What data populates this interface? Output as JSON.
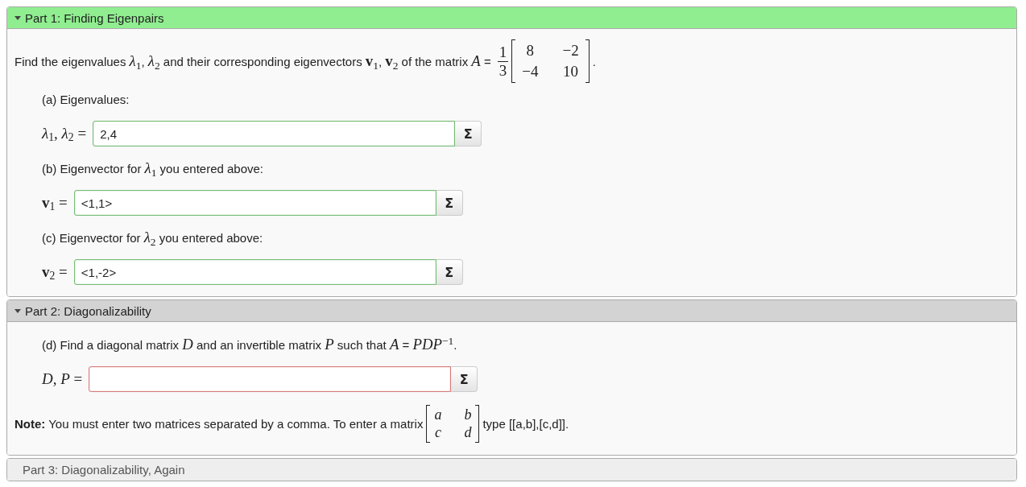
{
  "parts": [
    {
      "title": "Part 1: Finding Eigenpairs",
      "completed": true,
      "locked": false,
      "expanded": true,
      "intro": [
        {
          "kind": "text",
          "text": "Find the eigenvalues *λ*$_{1}$, *λ*$_{2}$ and their corresponding eigenvectors **v**$_{1}$, **v**$_{2}$ of the matrix *A* ="
        },
        {
          "kind": "fraction",
          "numerator": "1",
          "denominator": "3"
        },
        {
          "kind": "matrix",
          "rows": [
            [
              "8",
              "−2"
            ],
            [
              "−4",
              "10"
            ]
          ]
        },
        {
          "kind": "text",
          "text": "."
        }
      ],
      "questions": [
        {
          "prompt": "(a) Eigenvalues:",
          "label": "*λ*$_{1}$, *λ*$_{2}$ =",
          "value": "2,4",
          "correct": true,
          "button": "Σ"
        },
        {
          "prompt": "(b) Eigenvector for *λ*$_{1}$ you entered above:",
          "label": "**v**$_{1}$ =",
          "value": "<1,1>",
          "correct": true,
          "button": "Σ"
        },
        {
          "prompt": "(c) Eigenvector for *λ*$_{2}$ you entered above:",
          "label": "**v**$_{2}$ =",
          "value": "<1,-2>",
          "correct": true,
          "button": "Σ"
        }
      ]
    },
    {
      "title": "Part 2: Diagonalizability",
      "completed": false,
      "locked": false,
      "expanded": true,
      "questions": [
        {
          "prompt": "(d) Find a diagonal matrix *D* and an invertible matrix *P* such that *A* = *PDP*$^{−1}$.",
          "label": "*D*, *P* =",
          "correct": false,
          "button": "Σ"
        }
      ],
      "note": [
        {
          "kind": "text",
          "text": "**Note:** You must enter two matrices separated by a comma. To enter a matrix"
        },
        {
          "kind": "symbolic_matrix",
          "rows": [
            [
              "a",
              "b"
            ],
            [
              "c",
              "d"
            ]
          ]
        },
        {
          "kind": "text",
          "text": "type [[a,b],[c,d]]."
        }
      ]
    },
    {
      "title": "Part 3: Diagonalizability, Again",
      "completed": false,
      "locked": true,
      "expanded": false
    }
  ]
}
